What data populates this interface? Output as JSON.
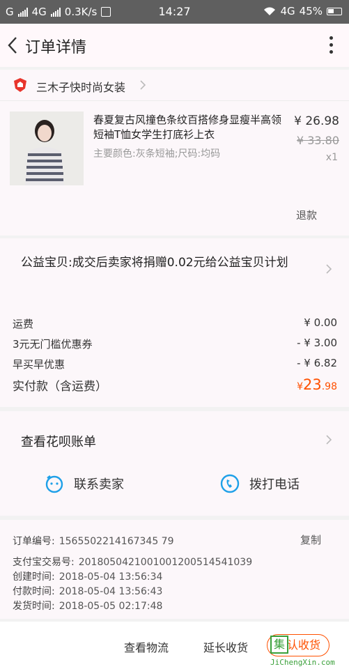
{
  "status_bar": {
    "carrier_left": "G",
    "network": "4G",
    "speed": "0.3K/s",
    "time": "14:27",
    "net_right": "4G",
    "battery": "45%"
  },
  "header": {
    "title": "订单详情",
    "back_icon": "chevron-left-icon",
    "more_icon": "more-vertical-icon"
  },
  "shop": {
    "name": "三木子快时尚女装"
  },
  "product": {
    "title": "春夏复古风撞色条纹百搭修身显瘦半高领短袖T恤女学生打底衫上衣",
    "spec": "主要颜色:灰条短袖;尺码:均码",
    "price": "¥ 26.98",
    "original_price": "¥ 33.80",
    "quantity": "x1",
    "refund_label": "退款"
  },
  "charity": {
    "text": "公益宝贝:成交后卖家将捐赠0.02元给公益宝贝计划"
  },
  "fees": {
    "shipping_label": "运费",
    "shipping_value": "¥ 0.00",
    "coupon_label": "3元无门槛优惠券",
    "coupon_value": "- ¥ 3.00",
    "early_label": "早买早优惠",
    "early_value": "- ¥ 6.82",
    "total_label": "实付款（含运费）",
    "total_currency": "¥",
    "total_int": "23",
    "total_dec": ".98"
  },
  "actions": {
    "huabei_label": "查看花呗账单",
    "contact_seller": "联系卖家",
    "call_phone": "拨打电话"
  },
  "order_info": {
    "order_no_label": "订单编号:",
    "order_no": "1565502214167345 79",
    "copy_label": "复制",
    "alipay_label": "支付宝交易号:",
    "alipay_no": "2018050421001001200514541039",
    "created_label": "创建时间:",
    "created": "2018-05-04 13:56:34",
    "paid_label": "付款时间:",
    "paid": "2018-05-04 13:56:43",
    "shipped_label": "发货时间:",
    "shipped": "2018-05-05 02:17:48"
  },
  "bottom": {
    "logistics": "查看物流",
    "extend": "延长收货",
    "confirm": "确认收货"
  },
  "watermark": {
    "char": "集",
    "text": "JiChengXin.com"
  },
  "colors": {
    "accent": "#ff5000",
    "icon_blue": "#1ea0e8"
  }
}
